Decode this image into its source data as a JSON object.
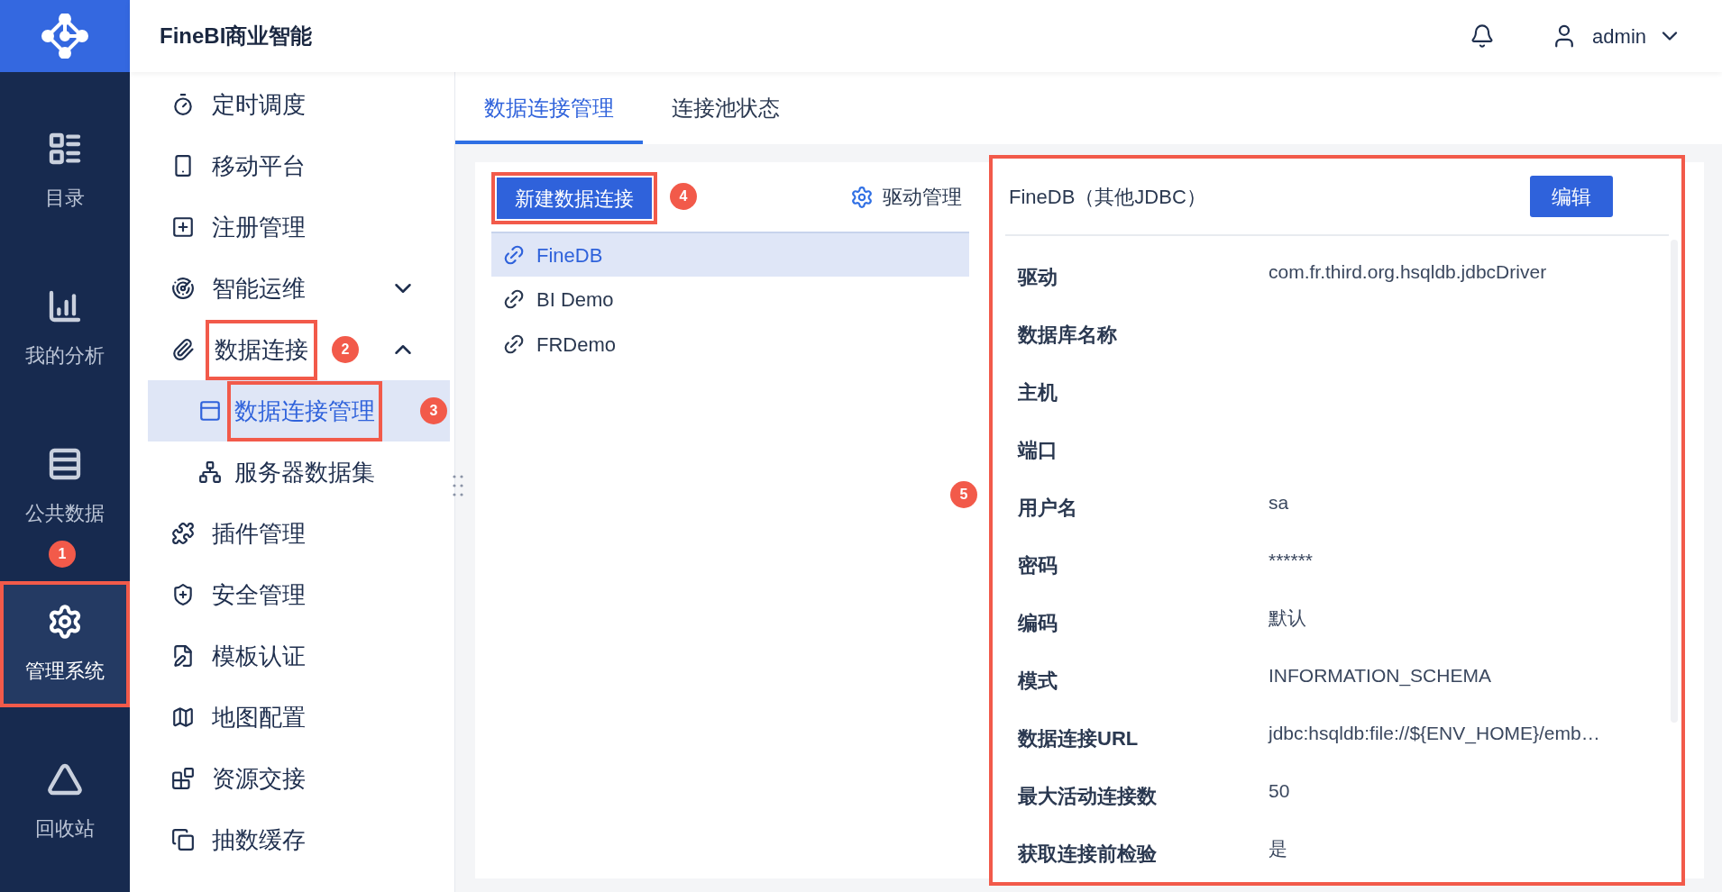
{
  "app": {
    "title": "FineBI商业智能"
  },
  "header": {
    "user": "admin"
  },
  "nav": [
    {
      "label": "目录",
      "selected": false,
      "outlined": false
    },
    {
      "label": "我的分析",
      "selected": false,
      "outlined": false
    },
    {
      "label": "公共数据",
      "selected": false,
      "outlined": false
    },
    {
      "label": "管理系统",
      "selected": true,
      "outlined": true,
      "callout": "1"
    },
    {
      "label": "回收站",
      "selected": false,
      "outlined": false
    }
  ],
  "menu": [
    {
      "kind": "item",
      "label": "定时调度",
      "selected": false,
      "outlined": false
    },
    {
      "kind": "item",
      "label": "移动平台",
      "selected": false,
      "outlined": false
    },
    {
      "kind": "item",
      "label": "注册管理",
      "selected": false,
      "outlined": false
    },
    {
      "kind": "group",
      "label": "智能运维",
      "expanded": false,
      "outlined": false
    },
    {
      "kind": "group",
      "label": "数据连接",
      "expanded": true,
      "outlined": true,
      "callout": "2",
      "children": [
        {
          "label": "数据连接管理",
          "selected": true,
          "outlined": true,
          "callout": "3"
        },
        {
          "label": "服务器数据集",
          "selected": false,
          "outlined": false
        }
      ]
    },
    {
      "kind": "item",
      "label": "插件管理",
      "selected": false,
      "outlined": false
    },
    {
      "kind": "item",
      "label": "安全管理",
      "selected": false,
      "outlined": false
    },
    {
      "kind": "item",
      "label": "模板认证",
      "selected": false,
      "outlined": false
    },
    {
      "kind": "item",
      "label": "地图配置",
      "selected": false,
      "outlined": false
    },
    {
      "kind": "item",
      "label": "资源交接",
      "selected": false,
      "outlined": false
    },
    {
      "kind": "item",
      "label": "抽数缓存",
      "selected": false,
      "outlined": false
    }
  ],
  "tabs": [
    {
      "label": "数据连接管理",
      "selected": true
    },
    {
      "label": "连接池状态",
      "selected": false
    }
  ],
  "connections": {
    "new_button": {
      "label": "新建数据连接",
      "outlined": true,
      "callout": "4"
    },
    "driver_link": "驱动管理",
    "items": [
      {
        "label": "FineDB",
        "selected": true
      },
      {
        "label": "BI Demo",
        "selected": false
      },
      {
        "label": "FRDemo",
        "selected": false
      }
    ]
  },
  "detail": {
    "title": "FineDB（其他JDBC）",
    "edit_button": "编辑",
    "outlined": true,
    "callout": "5",
    "rows": [
      {
        "label": "驱动",
        "value": "com.fr.third.org.hsqldb.jdbcDriver"
      },
      {
        "label": "数据库名称"
      },
      {
        "label": "主机"
      },
      {
        "label": "端口"
      },
      {
        "label": "用户名",
        "value": "sa"
      },
      {
        "label": "密码",
        "value": "******"
      },
      {
        "label": "编码",
        "value": "默认"
      },
      {
        "label": "模式",
        "value": "INFORMATION_SCHEMA"
      },
      {
        "label": "数据连接URL",
        "value": "jdbc:hsqldb:file://${ENV_HOME}/emb…"
      },
      {
        "label": "最大活动连接数",
        "value": "50"
      },
      {
        "label": "获取连接前检验",
        "value": "是"
      }
    ]
  }
}
